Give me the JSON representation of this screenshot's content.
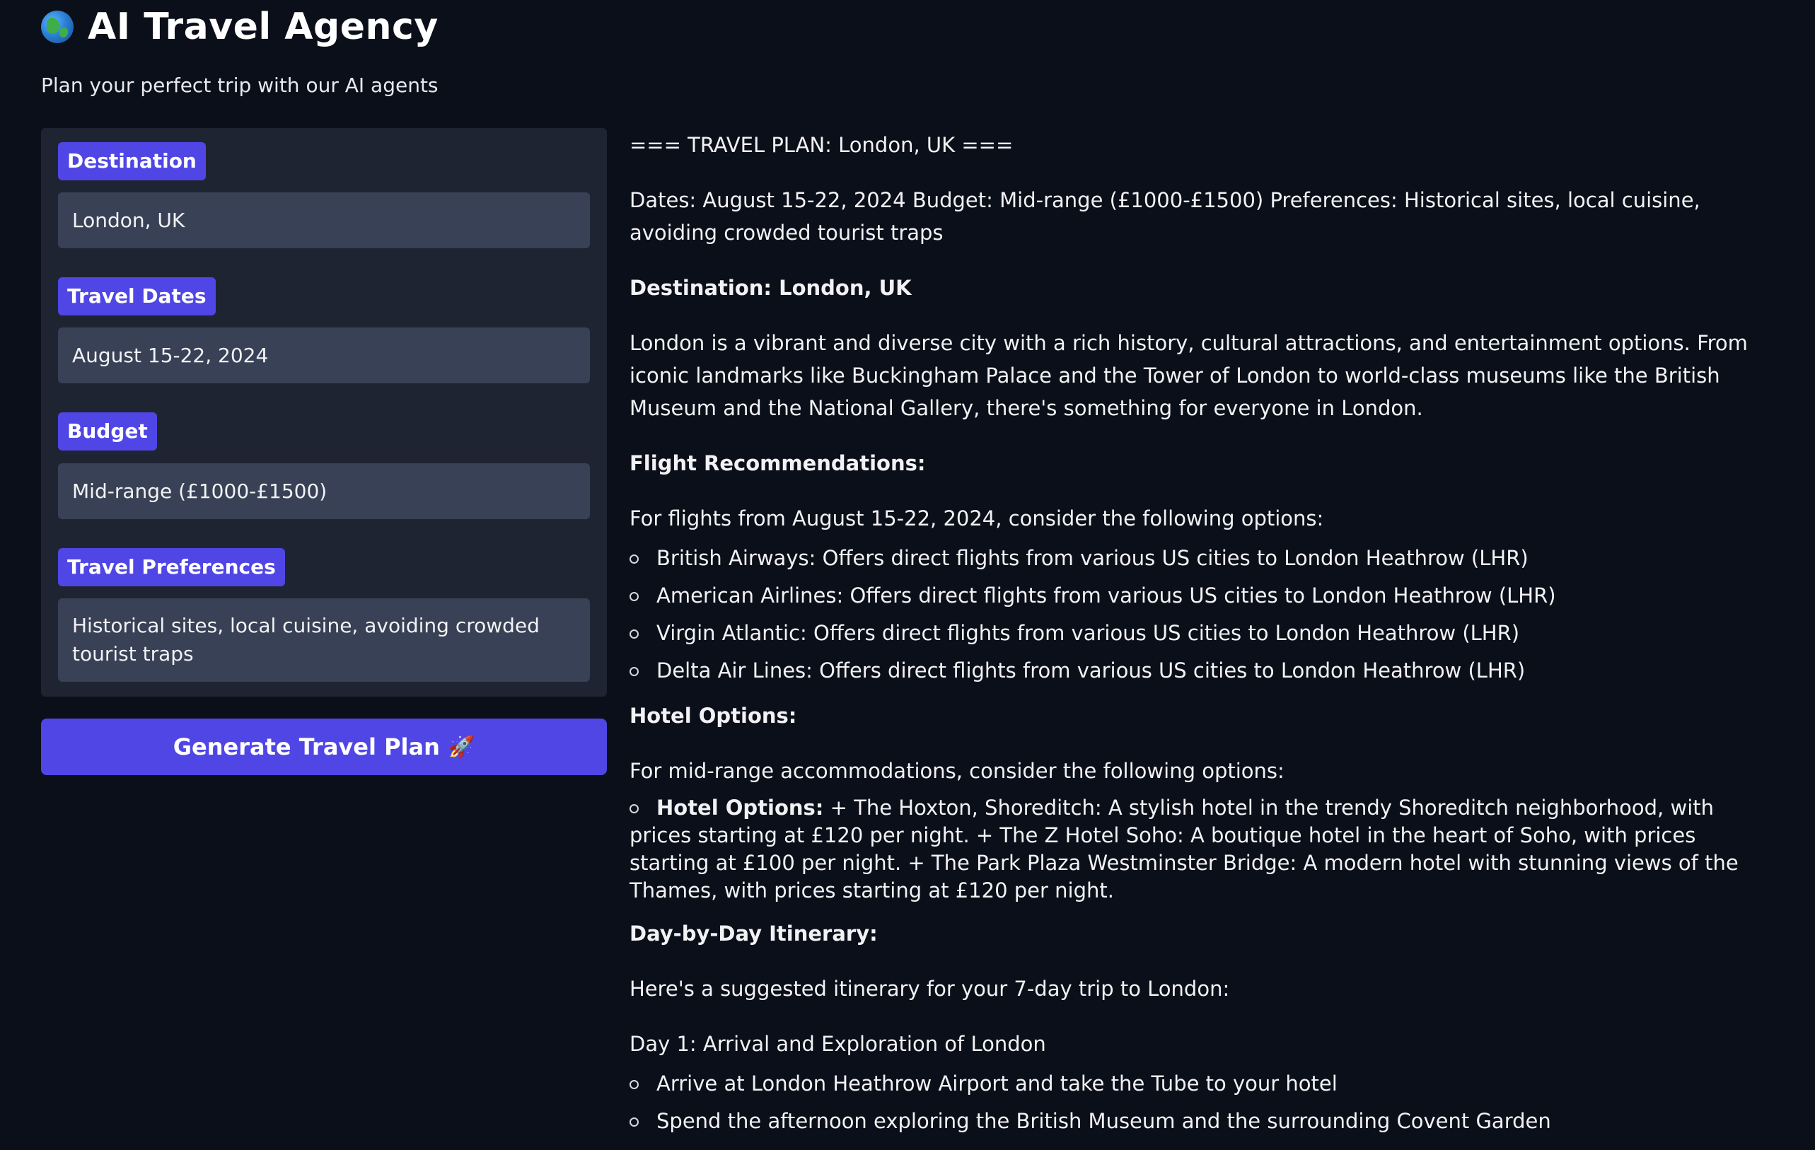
{
  "header": {
    "title": "AI Travel Agency",
    "subtitle": "Plan your perfect trip with our AI agents",
    "icon": "globe-icon"
  },
  "form": {
    "destination": {
      "label": "Destination",
      "value": "London, UK"
    },
    "dates": {
      "label": "Travel Dates",
      "value": "August 15-22, 2024"
    },
    "budget": {
      "label": "Budget",
      "value": "Mid-range (£1000-£1500)"
    },
    "preferences": {
      "label": "Travel Preferences",
      "value": "Historical sites, local cuisine, avoiding crowded tourist traps"
    },
    "generate_label": "Generate Travel Plan",
    "generate_icon": "rocket-icon"
  },
  "output": {
    "plan_title": "=== TRAVEL PLAN: London, UK ===",
    "summary": "Dates: August 15-22, 2024 Budget: Mid-range (£1000-£1500) Preferences: Historical sites, local cuisine, avoiding crowded tourist traps",
    "destination_heading": "Destination: London, UK",
    "destination_text": "London is a vibrant and diverse city with a rich history, cultural attractions, and entertainment options. From iconic landmarks like Buckingham Palace and the Tower of London to world-class museums like the British Museum and the National Gallery, there's something for everyone in London.",
    "flight_heading": "Flight Recommendations:",
    "flight_intro": "For flights from August 15-22, 2024, consider the following options:",
    "flights": [
      "British Airways: Offers direct flights from various US cities to London Heathrow (LHR)",
      "American Airlines: Offers direct flights from various US cities to London Heathrow (LHR)",
      "Virgin Atlantic: Offers direct flights from various US cities to London Heathrow (LHR)",
      "Delta Air Lines: Offers direct flights from various US cities to London Heathrow (LHR)"
    ],
    "hotel_heading": "Hotel Options:",
    "hotel_intro": "For mid-range accommodations, consider the following options:",
    "hotel_item_label": "Hotel Options:",
    "hotel_item_text": " + The Hoxton, Shoreditch: A stylish hotel in the trendy Shoreditch neighborhood, with prices starting at £120 per night. + The Z Hotel Soho: A boutique hotel in the heart of Soho, with prices starting at £100 per night. + The Park Plaza Westminster Bridge: A modern hotel with stunning views of the Thames, with prices starting at £120 per night.",
    "itinerary_heading": "Day-by-Day Itinerary:",
    "itinerary_intro": "Here's a suggested itinerary for your 7-day trip to London:",
    "day1_title": "Day 1: Arrival and Exploration of London",
    "day1_items": [
      "Arrive at London Heathrow Airport and take the Tube to your hotel",
      "Spend the afternoon exploring the British Museum and the surrounding Covent Garden"
    ]
  }
}
